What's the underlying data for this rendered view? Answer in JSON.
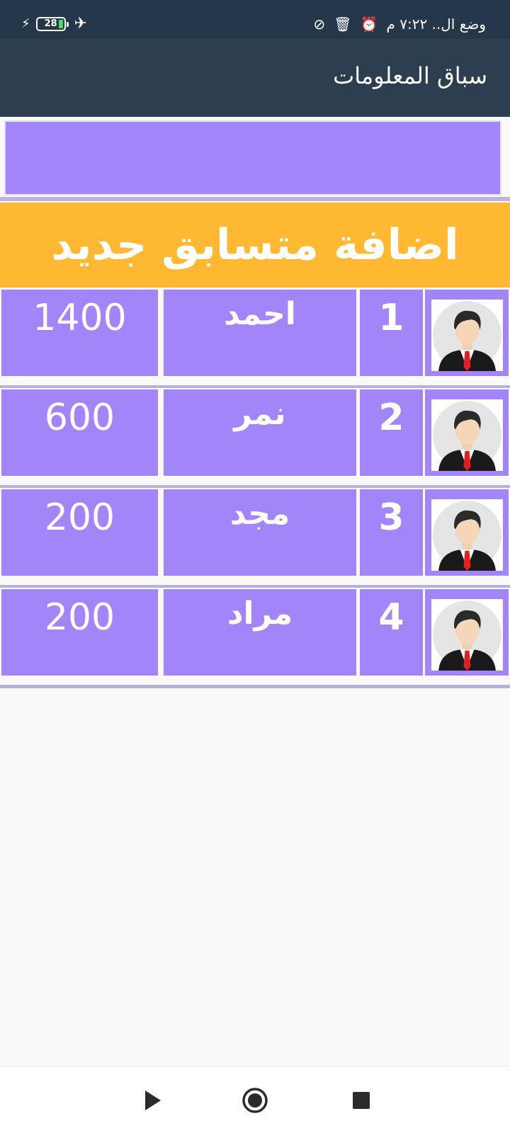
{
  "status_bar": {
    "battery_level": "28",
    "text": "وضع ال.. ٧:٢٢ م",
    "icons": [
      "charging-icon",
      "battery-icon",
      "airplane-icon",
      "alarm-icon",
      "trash-icon",
      "do-not-disturb-icon"
    ]
  },
  "app_bar": {
    "title": "سباق المعلومات"
  },
  "add_button": {
    "label": "اضافة متسابق جديد"
  },
  "contestants": [
    {
      "rank": "1",
      "name": "احمد",
      "score": "1400"
    },
    {
      "rank": "2",
      "name": "نمر",
      "score": "600"
    },
    {
      "rank": "3",
      "name": "مجد",
      "score": "200"
    },
    {
      "rank": "4",
      "name": "مراد",
      "score": "200"
    }
  ],
  "colors": {
    "status_bar": "#25374a",
    "app_bar": "#2c3e50",
    "purple": "#a385fa",
    "orange": "#ffb832",
    "background": "#f9f9f9"
  },
  "nav_bar": {
    "icons": [
      "back-triangle-icon",
      "home-circle-icon",
      "recents-square-icon"
    ]
  }
}
